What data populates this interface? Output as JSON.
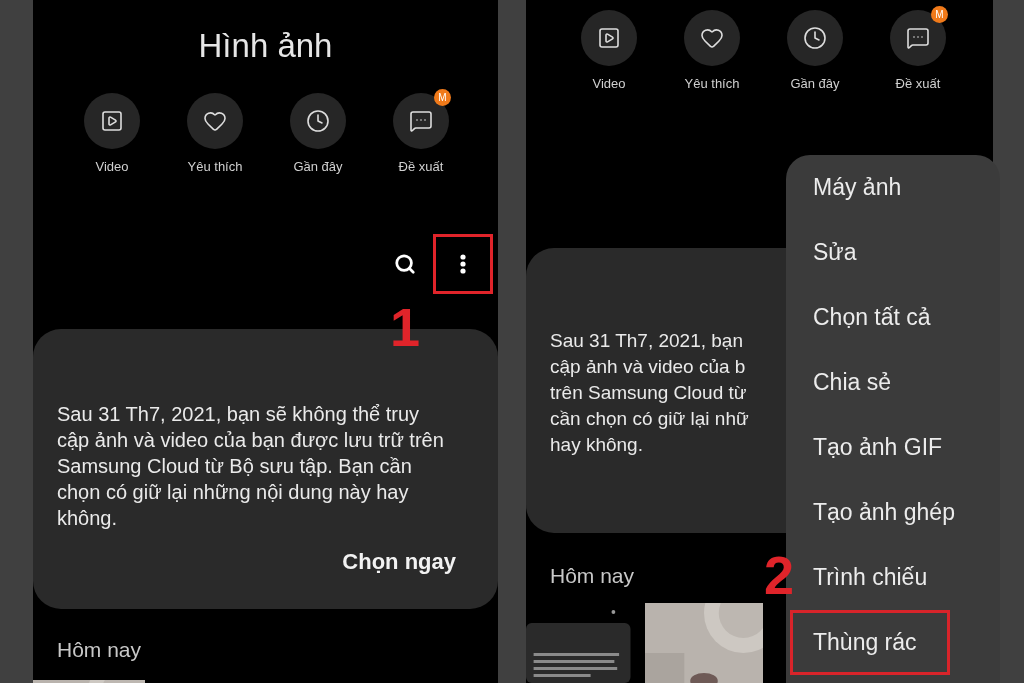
{
  "left_screen": {
    "title": "Hình ảnh",
    "shortcuts": [
      {
        "kind": "video",
        "label": "Video"
      },
      {
        "kind": "favorites",
        "label": "Yêu thích"
      },
      {
        "kind": "recent",
        "label": "Gần đây"
      },
      {
        "kind": "suggestions",
        "label": "Đề xuất",
        "badge": "M"
      }
    ],
    "more_button": {
      "highlighted": true
    },
    "step": "1",
    "notice": {
      "text": "Sau 31 Th7, 2021, bạn sẽ không thể truy cập ảnh và video của bạn được lưu trữ trên Samsung Cloud từ Bộ sưu tập. Bạn cần chọn có giữ lại những nội dung này hay không.",
      "action": "Chọn ngay"
    },
    "section": "Hôm nay"
  },
  "right_screen": {
    "shortcuts": [
      {
        "kind": "video",
        "label": "Video"
      },
      {
        "kind": "favorites",
        "label": "Yêu thích"
      },
      {
        "kind": "recent",
        "label": "Gần đây"
      },
      {
        "kind": "suggestions",
        "label": "Đề xuất",
        "badge": "M"
      }
    ],
    "notice_lines": [
      "Sau 31 Th7, 2021, bạn",
      "cập ảnh và video của b",
      "trên Samsung Cloud từ",
      "cần chọn có giữ lại nhữ",
      "hay không."
    ],
    "section": "Hôm nay",
    "step": "2",
    "menu": [
      {
        "label": "Máy ảnh",
        "highlighted": false
      },
      {
        "label": "Sửa",
        "highlighted": false
      },
      {
        "label": "Chọn tất cả",
        "highlighted": false
      },
      {
        "label": "Chia sẻ",
        "highlighted": false
      },
      {
        "label": "Tạo ảnh GIF",
        "highlighted": false
      },
      {
        "label": "Tạo ảnh ghép",
        "highlighted": false
      },
      {
        "label": "Trình chiếu",
        "highlighted": false
      },
      {
        "label": "Thùng rác",
        "highlighted": true
      }
    ]
  }
}
